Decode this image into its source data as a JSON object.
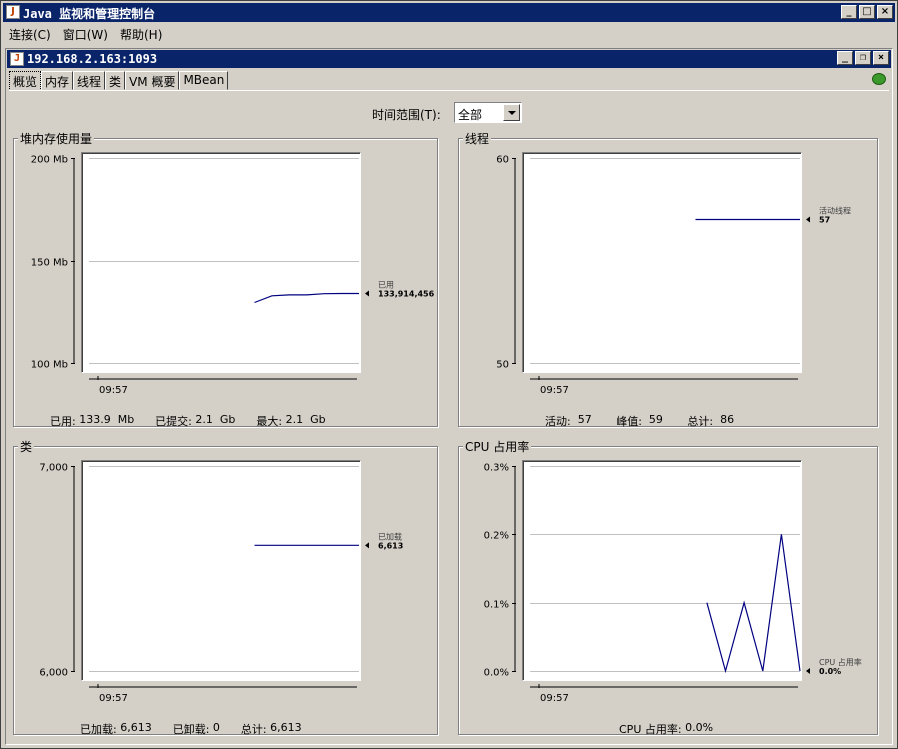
{
  "window": {
    "title": "Java 监视和管理控制台",
    "buttons": [
      "_",
      "□",
      "×"
    ]
  },
  "menu": [
    "连接(C)",
    "窗口(W)",
    "帮助(H)"
  ],
  "connection": {
    "title": "192.168.2.163:1093",
    "buttons": [
      "_",
      "❐",
      "×"
    ]
  },
  "tabs": [
    "概览",
    "内存",
    "线程",
    "类",
    "VM 概要",
    "MBean"
  ],
  "time_range": {
    "label": "时间范围(T):",
    "value": "全部"
  },
  "panels": {
    "heap": {
      "title": "堆内存使用量",
      "stats": [
        {
          "label": "已用:",
          "value": "133.9  Mb"
        },
        {
          "label": "已提交:",
          "value": "2.1  Gb"
        },
        {
          "label": "最大:",
          "value": "2.1  Gb"
        }
      ]
    },
    "threads": {
      "title": "线程",
      "stats": [
        {
          "label": "活动:",
          "value": "57"
        },
        {
          "label": "峰值:",
          "value": "59"
        },
        {
          "label": "总计:",
          "value": "86"
        }
      ]
    },
    "classes": {
      "title": "类",
      "stats": [
        {
          "label": "已加载:",
          "value": "6,613"
        },
        {
          "label": "已卸载:",
          "value": "0"
        },
        {
          "label": "总计:",
          "value": "6,613"
        }
      ]
    },
    "cpu": {
      "title": "CPU 占用率",
      "stats": [
        {
          "label": "CPU 占用率:",
          "value": "0.0%"
        }
      ]
    }
  },
  "colors": {
    "line": "#000080",
    "titlebar": "#0a246a",
    "background": "#d4d0c8"
  },
  "chart_data": [
    {
      "id": "heap",
      "type": "line",
      "yunit": "Mb",
      "ylim": [
        100,
        200
      ],
      "yticks": [
        "100 Mb",
        "150 Mb",
        "200 Mb"
      ],
      "ytick_values": [
        100,
        150,
        200
      ],
      "xticks": [
        "09:57"
      ],
      "x": [
        0,
        1,
        2,
        3,
        4,
        5,
        6
      ],
      "values": [
        129.5,
        132.8,
        133.2,
        133.2,
        133.8,
        133.9,
        133.9
      ],
      "xlim": [
        -9.5,
        6
      ],
      "label": "已用",
      "label_value": "133,914,456"
    },
    {
      "id": "threads",
      "type": "line",
      "ylim": [
        50,
        60
      ],
      "yticks": [
        "50",
        "60"
      ],
      "ytick_values": [
        50,
        60
      ],
      "xticks": [
        "09:57"
      ],
      "x": [
        0,
        6
      ],
      "values": [
        57,
        57
      ],
      "xlim": [
        -9.5,
        6
      ],
      "label": "活动线程",
      "label_value": "57"
    },
    {
      "id": "classes",
      "type": "line",
      "ylim": [
        6000,
        7000
      ],
      "yticks": [
        "6,000",
        "7,000"
      ],
      "ytick_values": [
        6000,
        7000
      ],
      "xticks": [
        "09:57"
      ],
      "x": [
        0,
        6
      ],
      "values": [
        6613,
        6613
      ],
      "xlim": [
        -9.5,
        6
      ],
      "label": "已加载",
      "label_value": "6,613"
    },
    {
      "id": "cpu",
      "type": "line",
      "ylim": [
        0,
        0.3
      ],
      "yticks": [
        "0.0%",
        "0.1%",
        "0.2%",
        "0.3%"
      ],
      "ytick_values": [
        0,
        0.1,
        0.2,
        0.3
      ],
      "xticks": [
        "09:57"
      ],
      "x": [
        0,
        1,
        2,
        3,
        4,
        5
      ],
      "values": [
        0.1,
        0.0,
        0.1,
        0.0,
        0.2,
        0.0
      ],
      "xlim": [
        -9.5,
        5
      ],
      "label": "CPU 占用率",
      "label_value": "0.0%"
    }
  ]
}
